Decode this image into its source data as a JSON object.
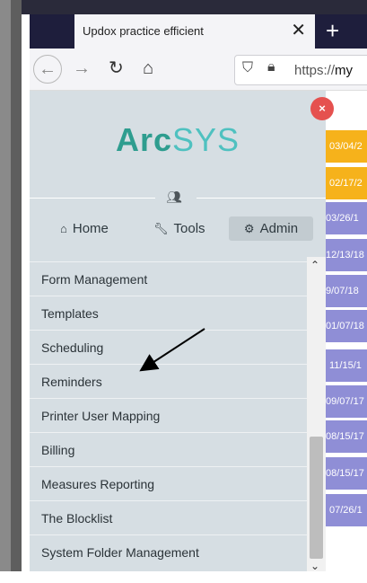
{
  "browser": {
    "tab_title": "Updox practice efficient",
    "tab_close": "✕",
    "new_tab": "+",
    "url_scheme": "https://",
    "url_host": "my"
  },
  "app": {
    "brand_part1": "Arc",
    "brand_part2": "SYS",
    "nav": [
      {
        "label": "Home",
        "icon": "home-icon"
      },
      {
        "label": "Tools",
        "icon": "wrench-icon"
      },
      {
        "label": "Admin",
        "icon": "gears-icon",
        "active": true
      }
    ],
    "menu_items": [
      "Form Management",
      "Templates",
      "Scheduling",
      "Reminders",
      "Printer User Mapping",
      "Billing",
      "Measures Reporting",
      "The Blocklist",
      "System Folder Management"
    ],
    "close_badge": "×"
  },
  "background_list": {
    "dates": [
      "03/04/2",
      "02/17/2",
      "03/26/1",
      "12/13/18",
      "9/07/18",
      "01/07/18",
      "11/15/1",
      "09/07/17",
      "08/15/17",
      "08/15/17",
      "07/26/1"
    ],
    "colors": {
      "highlight": "#f6b21b",
      "row": "#8f8ed6"
    }
  }
}
